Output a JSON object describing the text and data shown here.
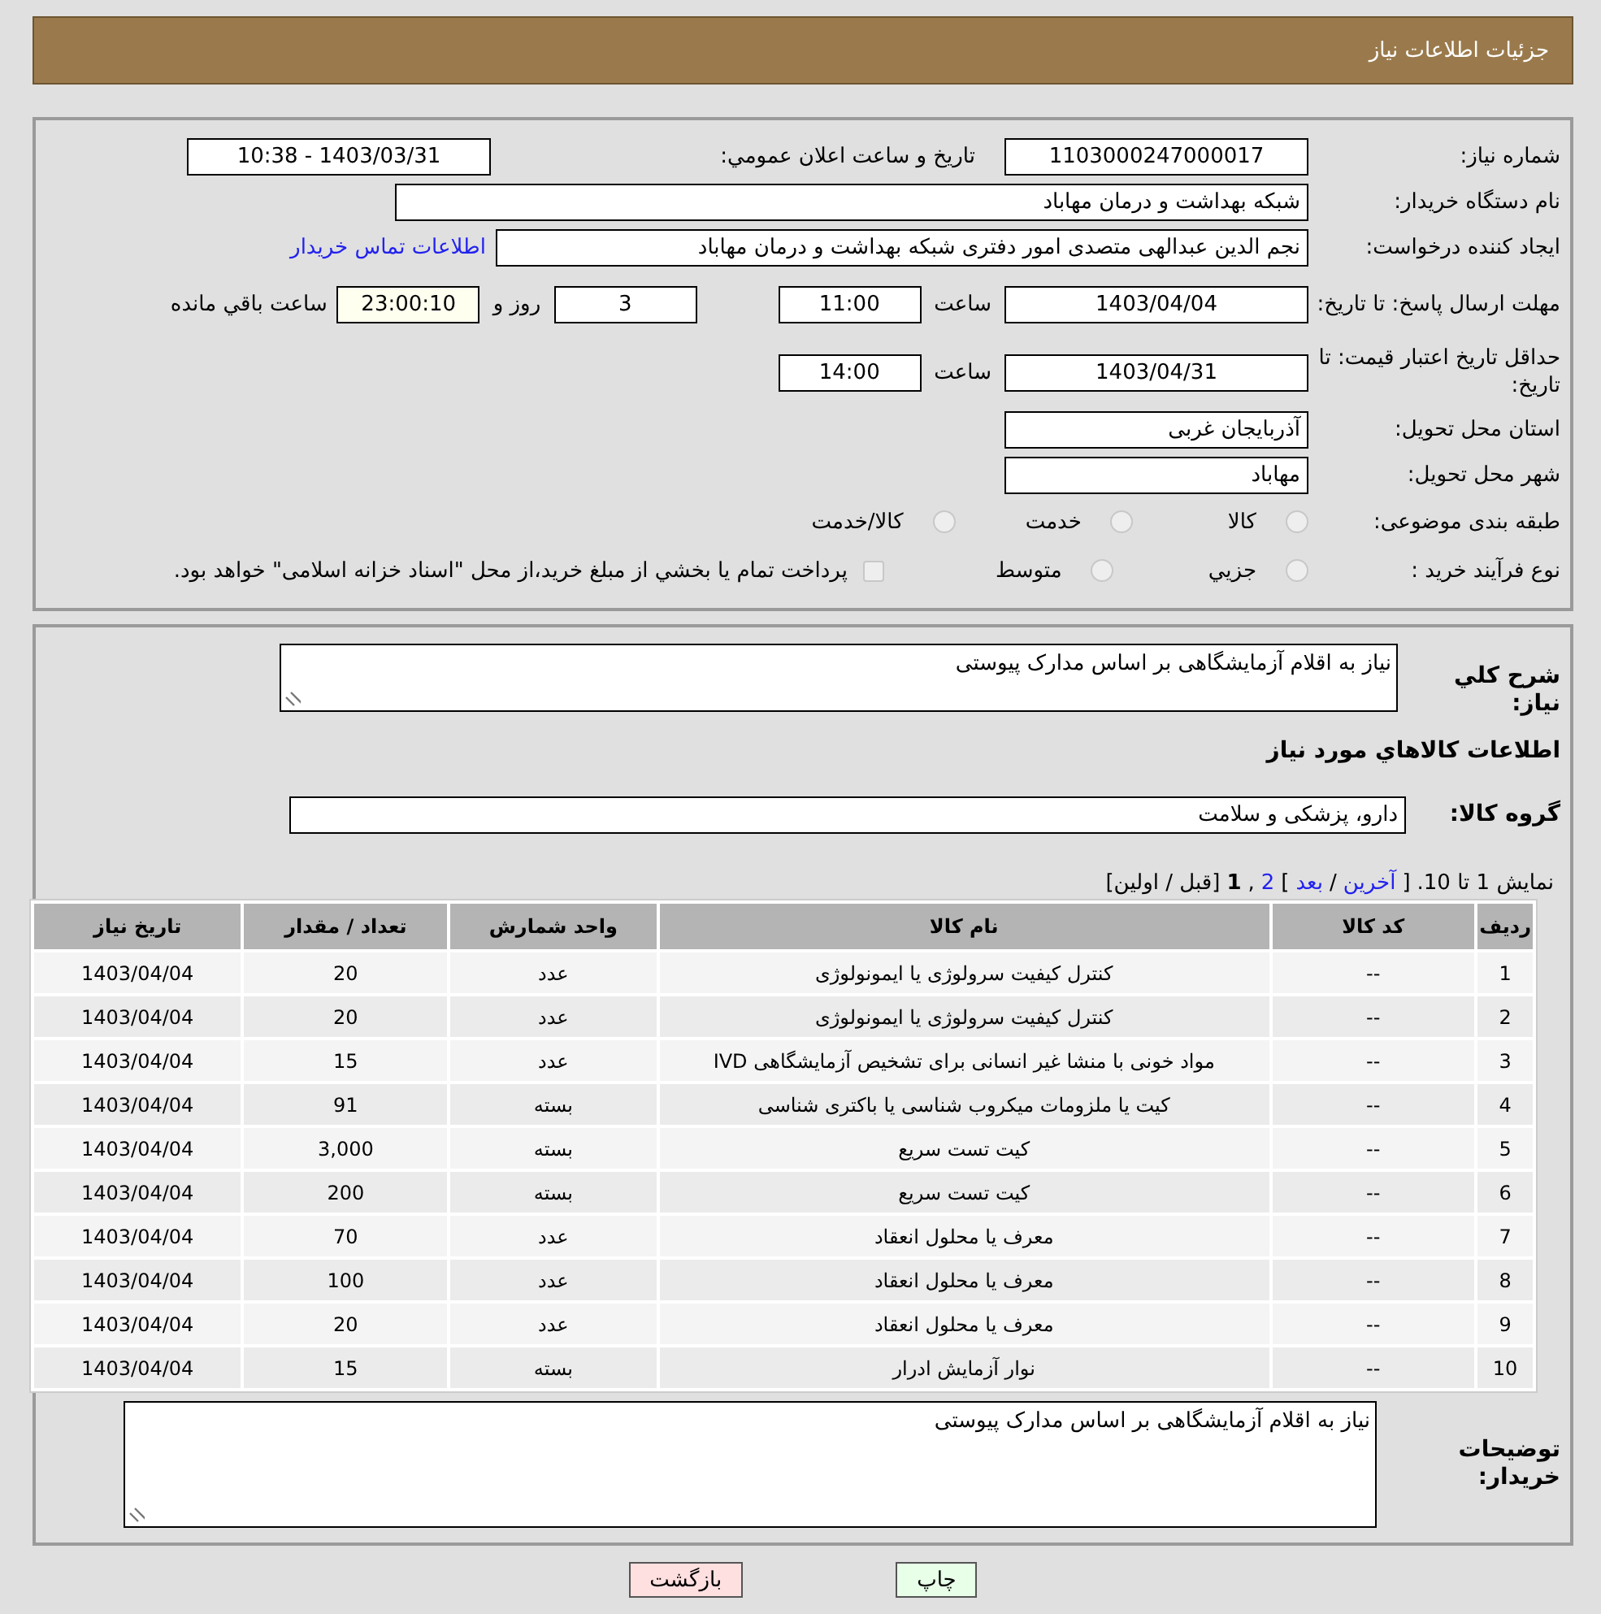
{
  "header": {
    "title": "جزئیات اطلاعات نیاز"
  },
  "details": {
    "need_number": {
      "label": "شماره نیاز:",
      "value": "1103000247000017"
    },
    "announce": {
      "label": "تاريخ و ساعت اعلان عمومي:",
      "value": "1403/03/31 - 10:38"
    },
    "buyer": {
      "label": "نام دستگاه خريدار:",
      "value": "شبکه بهداشت و درمان مهاباد"
    },
    "creator": {
      "label": "ايجاد کننده درخواست:",
      "value": "نجم الدین عبدالهی متصدی امور دفتری شبکه بهداشت و درمان مهاباد",
      "link": "اطلاعات تماس خريدار"
    },
    "deadline": {
      "label": "مهلت ارسال پاسخ: تا تاریخ:",
      "date": "1403/04/04",
      "time_label": "ساعت",
      "time": "11:00",
      "days": "3",
      "days_label": "روز و",
      "remaining": "23:00:10",
      "remaining_label": "ساعت باقي مانده"
    },
    "validity": {
      "label": "حداقل تاریخ اعتبار قیمت: تا تاریخ:",
      "date": "1403/04/31",
      "time_label": "ساعت",
      "time": "14:00"
    },
    "province": {
      "label": "استان محل تحویل:",
      "value": "آذربایجان غربی"
    },
    "city": {
      "label": "شهر محل تحویل:",
      "value": "مهاباد"
    },
    "category": {
      "label": "طبقه بندی موضوعی:",
      "options": [
        {
          "label": "کالا",
          "selected": false
        },
        {
          "label": "خدمت",
          "selected": false
        },
        {
          "label": "کالا/خدمت",
          "selected": false
        }
      ]
    },
    "process": {
      "label": "نوع فرآیند خرید :",
      "options": [
        {
          "label": "جزيي",
          "selected": false
        },
        {
          "label": "متوسط",
          "selected": false
        }
      ],
      "treasury": {
        "checked": false,
        "text": "پرداخت تمام يا بخشي از مبلغ خريد،از محل \"اسناد خزانه اسلامی\" خواهد بود."
      }
    }
  },
  "description": {
    "label": "شرح كلي نياز:",
    "value": "نیاز به اقلام آزمایشگاهی بر اساس مدارک پیوستی"
  },
  "goods_title": "اطلاعات كالاهاي مورد نياز",
  "group": {
    "label": "گروه کالا:",
    "value": "دارو، پزشکی و سلامت"
  },
  "pager": [
    {
      "kind": "text",
      "text": "نمایش 1 تا 10."
    },
    {
      "kind": "text",
      "text": "["
    },
    {
      "kind": "link",
      "text": "آخرین"
    },
    {
      "kind": "text",
      "text": "/"
    },
    {
      "kind": "link",
      "text": "بعد"
    },
    {
      "kind": "text",
      "text": "]"
    },
    {
      "kind": "link",
      "text": "2"
    },
    {
      "kind": "text",
      "text": ","
    },
    {
      "kind": "current",
      "text": "1"
    },
    {
      "kind": "text",
      "text": "[قبل / اولین]"
    }
  ],
  "table": {
    "columns": [
      "ردیف",
      "کد کالا",
      "نام کالا",
      "واحد شمارش",
      "تعداد / مقدار",
      "تاریخ نیاز"
    ],
    "rows": [
      [
        "1",
        "--",
        "کنترل کیفیت سرولوژی یا ایمونولوژی",
        "عدد",
        "20",
        "1403/04/04"
      ],
      [
        "2",
        "--",
        "کنترل کیفیت سرولوژی یا ایمونولوژی",
        "عدد",
        "20",
        "1403/04/04"
      ],
      [
        "3",
        "--",
        "مواد خونی با منشا غیر انسانی برای تشخیص آزمایشگاهی IVD",
        "عدد",
        "15",
        "1403/04/04"
      ],
      [
        "4",
        "--",
        "کیت یا ملزومات میکروب شناسی یا باکتری شناسی",
        "بسته",
        "91",
        "1403/04/04"
      ],
      [
        "5",
        "--",
        "کیت تست سریع",
        "بسته",
        "3,000",
        "1403/04/04"
      ],
      [
        "6",
        "--",
        "کیت تست سریع",
        "بسته",
        "200",
        "1403/04/04"
      ],
      [
        "7",
        "--",
        "معرف یا محلول انعقاد",
        "عدد",
        "70",
        "1403/04/04"
      ],
      [
        "8",
        "--",
        "معرف یا محلول انعقاد",
        "عدد",
        "100",
        "1403/04/04"
      ],
      [
        "9",
        "--",
        "معرف یا محلول انعقاد",
        "عدد",
        "20",
        "1403/04/04"
      ],
      [
        "10",
        "--",
        "نوار آزمایش ادرار",
        "بسته",
        "15",
        "1403/04/04"
      ]
    ]
  },
  "buyer_notes": {
    "label": "توضیحات خریدار:",
    "value": "نیاز به اقلام آزمایشگاهی بر اساس مدارک پیوستی"
  },
  "buttons": [
    {
      "kind": "print",
      "label": "چاپ"
    },
    {
      "kind": "back",
      "label": "بازگشت"
    }
  ]
}
